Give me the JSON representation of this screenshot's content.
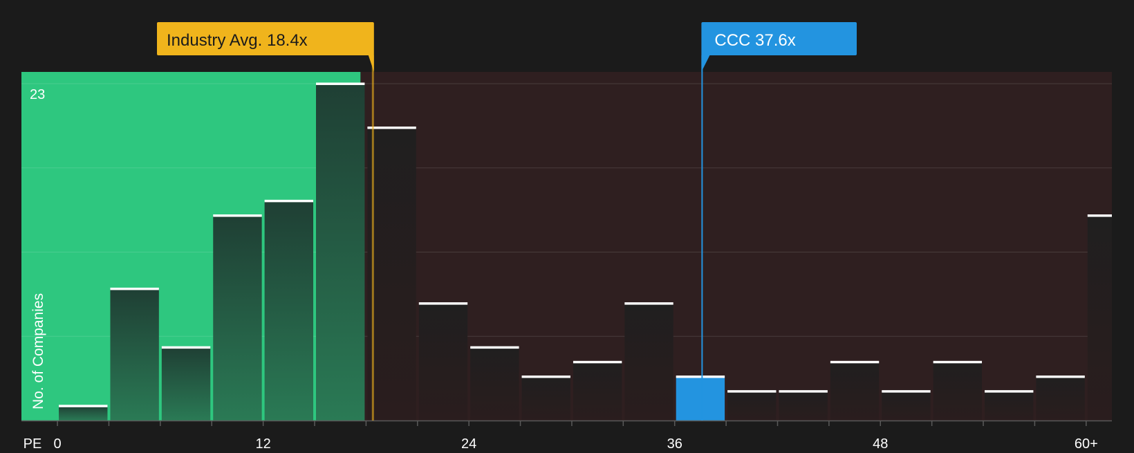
{
  "chart_data": {
    "type": "bar",
    "x_axis_label": "PE",
    "y_axis_label": "No. of Companies",
    "y_max_label": "23",
    "ylim": [
      0,
      23.8
    ],
    "xlim": [
      -2.1,
      61.5
    ],
    "x_ticks": [
      {
        "value": 0,
        "label": "0"
      },
      {
        "value": 12,
        "label": "12"
      },
      {
        "value": 24,
        "label": "24"
      },
      {
        "value": 36,
        "label": "36"
      },
      {
        "value": 48,
        "label": "48"
      },
      {
        "value": 60,
        "label": "60+"
      }
    ],
    "bin_width": 3,
    "bins": [
      {
        "start": 0,
        "count": 1,
        "highlight": false
      },
      {
        "start": 3,
        "count": 9,
        "highlight": false
      },
      {
        "start": 6,
        "count": 5,
        "highlight": false
      },
      {
        "start": 9,
        "count": 14,
        "highlight": false
      },
      {
        "start": 12,
        "count": 15,
        "highlight": false
      },
      {
        "start": 15,
        "count": 23,
        "highlight": false
      },
      {
        "start": 18,
        "count": 20,
        "highlight": false
      },
      {
        "start": 21,
        "count": 8,
        "highlight": false
      },
      {
        "start": 24,
        "count": 5,
        "highlight": false
      },
      {
        "start": 27,
        "count": 3,
        "highlight": false
      },
      {
        "start": 30,
        "count": 4,
        "highlight": false
      },
      {
        "start": 33,
        "count": 8,
        "highlight": false
      },
      {
        "start": 36,
        "count": 3,
        "highlight": true
      },
      {
        "start": 39,
        "count": 2,
        "highlight": false
      },
      {
        "start": 42,
        "count": 2,
        "highlight": false
      },
      {
        "start": 45,
        "count": 4,
        "highlight": false
      },
      {
        "start": 48,
        "count": 2,
        "highlight": false
      },
      {
        "start": 51,
        "count": 4,
        "highlight": false
      },
      {
        "start": 54,
        "count": 2,
        "highlight": false
      },
      {
        "start": 57,
        "count": 3,
        "highlight": false
      },
      {
        "start": 60,
        "count": 14,
        "highlight": false
      }
    ],
    "industry_avg": {
      "value": 18.4,
      "label": "Industry Avg. 18.4x"
    },
    "company": {
      "value": 37.6,
      "label": "CCC 37.6x"
    },
    "colors": {
      "background": "#1b1b1b",
      "undervalued_zone": "#2ec77f",
      "overvalued_zone": "#2f1f20",
      "industry_avg": "#f0b41c",
      "company": "#2394e0",
      "bar_cap": "#ffffff"
    }
  }
}
